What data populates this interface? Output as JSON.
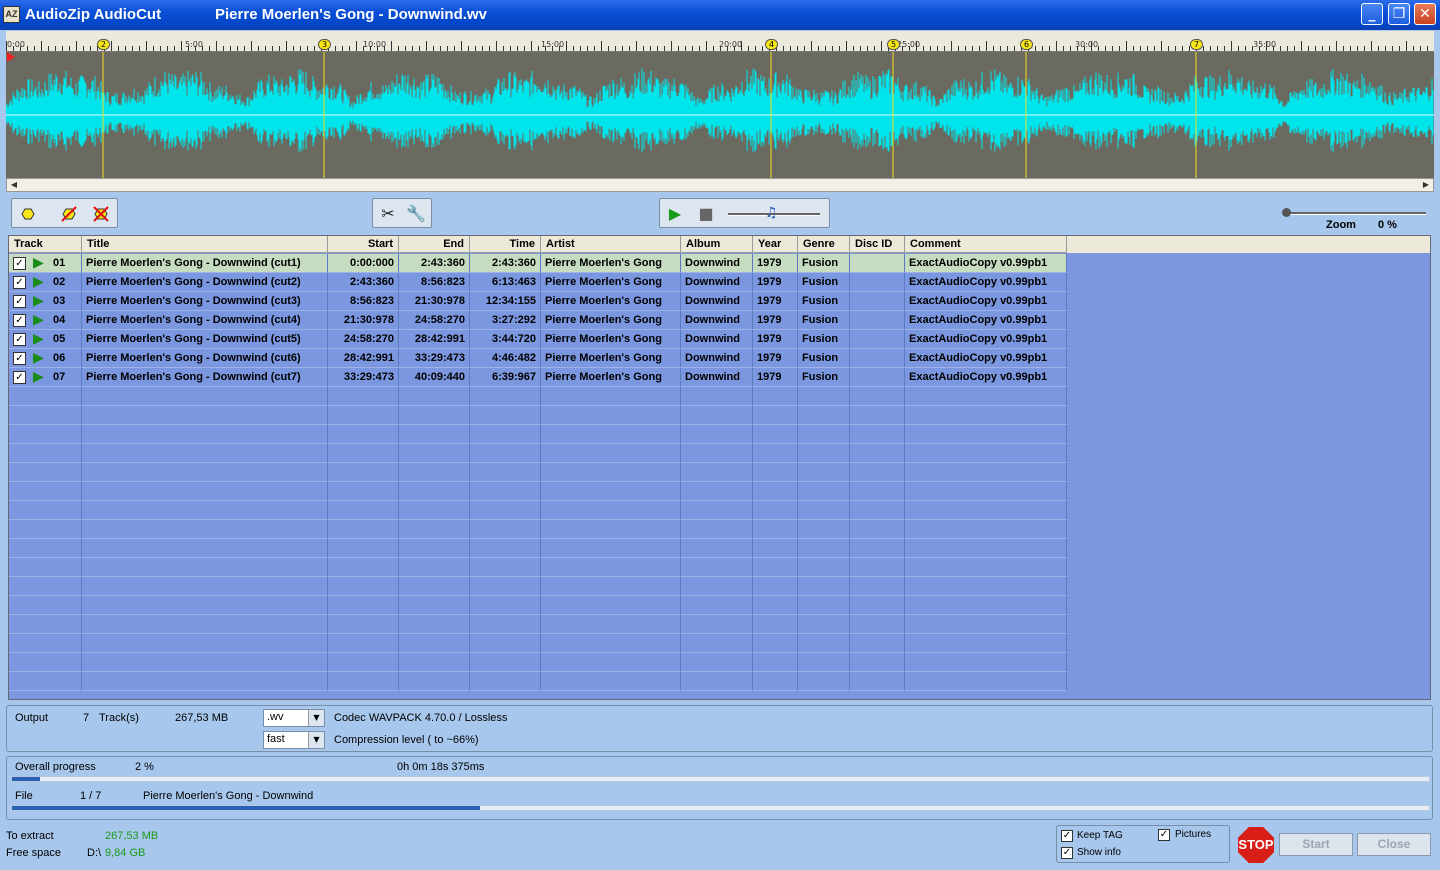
{
  "window": {
    "app_title": "AudioZip AudioCut",
    "file_title": "Pierre Moerlen's Gong - Downwind.wv",
    "app_icon": "AZ"
  },
  "ruler": {
    "time_labels": [
      "0:00",
      "5:00",
      "10:00",
      "15:00",
      "20:00",
      "25:00",
      "30:00",
      "35:00"
    ],
    "markers": [
      "2",
      "3",
      "4",
      "5",
      "6",
      "7"
    ]
  },
  "zoom": {
    "label": "Zoom",
    "value": "0 %"
  },
  "table": {
    "headers": [
      "Track",
      "Title",
      "Start",
      "End",
      "Time",
      "Artist",
      "Album",
      "Year",
      "Genre",
      "Disc ID",
      "Comment"
    ],
    "rows": [
      {
        "track": "01",
        "title": "Pierre Moerlen's Gong - Downwind (cut1)",
        "start": "0:00:000",
        "end": "2:43:360",
        "time": "2:43:360",
        "artist": "Pierre Moerlen's Gong",
        "album": "Downwind",
        "year": "1979",
        "genre": "Fusion",
        "disc_id": "",
        "comment": "ExactAudioCopy v0.99pb1"
      },
      {
        "track": "02",
        "title": "Pierre Moerlen's Gong - Downwind (cut2)",
        "start": "2:43:360",
        "end": "8:56:823",
        "time": "6:13:463",
        "artist": "Pierre Moerlen's Gong",
        "album": "Downwind",
        "year": "1979",
        "genre": "Fusion",
        "disc_id": "",
        "comment": "ExactAudioCopy v0.99pb1"
      },
      {
        "track": "03",
        "title": "Pierre Moerlen's Gong - Downwind (cut3)",
        "start": "8:56:823",
        "end": "21:30:978",
        "time": "12:34:155",
        "artist": "Pierre Moerlen's Gong",
        "album": "Downwind",
        "year": "1979",
        "genre": "Fusion",
        "disc_id": "",
        "comment": "ExactAudioCopy v0.99pb1"
      },
      {
        "track": "04",
        "title": "Pierre Moerlen's Gong - Downwind (cut4)",
        "start": "21:30:978",
        "end": "24:58:270",
        "time": "3:27:292",
        "artist": "Pierre Moerlen's Gong",
        "album": "Downwind",
        "year": "1979",
        "genre": "Fusion",
        "disc_id": "",
        "comment": "ExactAudioCopy v0.99pb1"
      },
      {
        "track": "05",
        "title": "Pierre Moerlen's Gong - Downwind (cut5)",
        "start": "24:58:270",
        "end": "28:42:991",
        "time": "3:44:720",
        "artist": "Pierre Moerlen's Gong",
        "album": "Downwind",
        "year": "1979",
        "genre": "Fusion",
        "disc_id": "",
        "comment": "ExactAudioCopy v0.99pb1"
      },
      {
        "track": "06",
        "title": "Pierre Moerlen's Gong - Downwind (cut6)",
        "start": "28:42:991",
        "end": "33:29:473",
        "time": "4:46:482",
        "artist": "Pierre Moerlen's Gong",
        "album": "Downwind",
        "year": "1979",
        "genre": "Fusion",
        "disc_id": "",
        "comment": "ExactAudioCopy v0.99pb1"
      },
      {
        "track": "07",
        "title": "Pierre Moerlen's Gong - Downwind (cut7)",
        "start": "33:29:473",
        "end": "40:09:440",
        "time": "6:39:967",
        "artist": "Pierre Moerlen's Gong",
        "album": "Downwind",
        "year": "1979",
        "genre": "Fusion",
        "disc_id": "",
        "comment": "ExactAudioCopy v0.99pb1"
      }
    ]
  },
  "output": {
    "label": "Output",
    "track_count": "7",
    "tracks_label": "Track(s)",
    "size": "267,53 MB",
    "format_value": ".wv",
    "codec": "Codec WAVPACK 4.70.0 / Lossless",
    "level_value": "fast",
    "compression": "Compression level ( to ~66%)"
  },
  "progress": {
    "overall_label": "Overall progress",
    "overall_value": "2 %",
    "overall_fraction": 0.02,
    "elapsed": "0h 0m 18s 375ms",
    "file_label": "File",
    "file_count": "1 / 7",
    "file_name": "Pierre Moerlen's Gong - Downwind",
    "file_fraction": 0.33
  },
  "footer": {
    "extract_label": "To extract",
    "extract_value": "267,53 MB",
    "free_label": "Free space",
    "free_drive": "D:\\",
    "free_value": "9,84 GB",
    "keep_tag": "Keep TAG",
    "pictures": "Pictures",
    "show_info": "Show info",
    "stop": "STOP",
    "start": "Start",
    "close": "Close"
  },
  "colors": {
    "waveform": "#00e5ec",
    "marker_line": "#f0e01e",
    "grid_bg": "#7b97e0",
    "selected_row": "#c5dcc0"
  }
}
